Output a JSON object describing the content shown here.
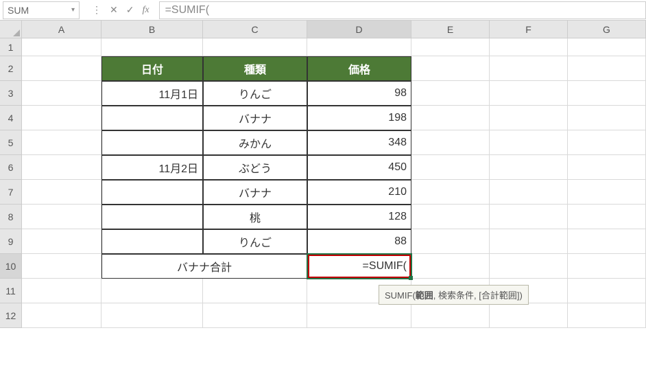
{
  "nameBox": "SUM",
  "formulaInput": "=SUMIF(",
  "columns": [
    "A",
    "B",
    "C",
    "D",
    "E",
    "F",
    "G"
  ],
  "rowNumbers": [
    "1",
    "2",
    "3",
    "4",
    "5",
    "6",
    "7",
    "8",
    "9",
    "10",
    "11",
    "12"
  ],
  "tableHeaders": {
    "b": "日付",
    "c": "種類",
    "d": "価格"
  },
  "rowsData": [
    {
      "b": "11月1日",
      "c": "りんご",
      "d": "98"
    },
    {
      "b": "",
      "c": "バナナ",
      "d": "198"
    },
    {
      "b": "",
      "c": "みかん",
      "d": "348"
    },
    {
      "b": "11月2日",
      "c": "ぶどう",
      "d": "450"
    },
    {
      "b": "",
      "c": "バナナ",
      "d": "210"
    },
    {
      "b": "",
      "c": "桃",
      "d": "128"
    },
    {
      "b": "",
      "c": "りんご",
      "d": "88"
    }
  ],
  "totalRow": {
    "label": "バナナ合計",
    "formula": "=SUMIF("
  },
  "tooltip": {
    "fn": "SUMIF(",
    "arg1": "範囲",
    "rest": ", 検索条件, [合計範囲])"
  },
  "icons": {
    "cancel": "✕",
    "enter": "✓",
    "fx": "fx",
    "dropdown": "▾",
    "menu": "⋮"
  }
}
